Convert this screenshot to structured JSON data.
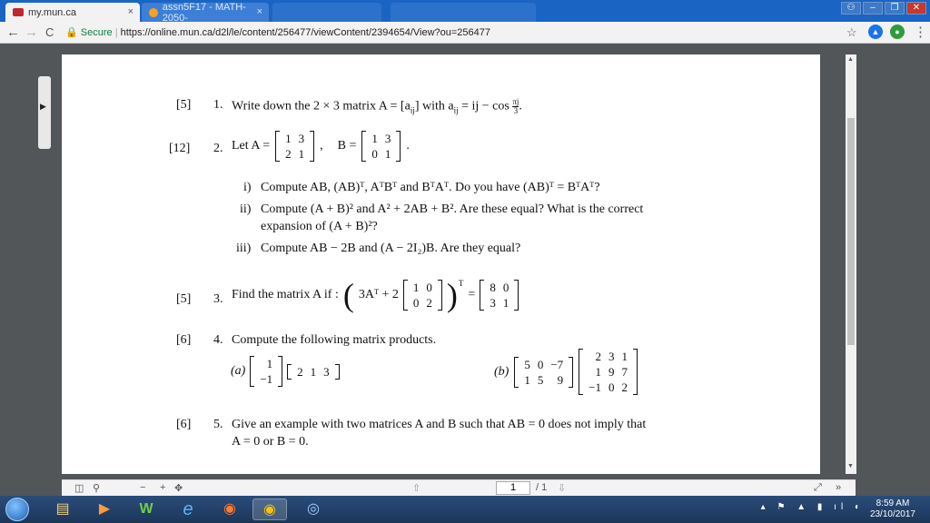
{
  "browser": {
    "tabs": [
      {
        "title": "my.mun.ca"
      },
      {
        "title": "assn5F17 - MATH-2050-"
      }
    ],
    "tab_close": "×",
    "nav": {
      "back": "←",
      "forward": "→",
      "reload": "C"
    },
    "secure_label": "Secure",
    "url": "https://online.mun.ca/d2l/le/content/256477/viewContent/2394654/View?ou=256477",
    "star": "☆",
    "menu": "⋮"
  },
  "doc": {
    "q1": {
      "marks": "[5]",
      "num": "1.",
      "text": "Write down the 2 × 3 matrix A = [a",
      "sub": "ij",
      "text2": "] with a",
      "sub2": "ij",
      "text3": " = ij − cos ",
      "frac_num": "πj",
      "frac_den": "3",
      "end": "."
    },
    "q2": {
      "marks": "[12]",
      "num": "2.",
      "let": "Let A =",
      "A": [
        [
          "1",
          "3"
        ],
        [
          "2",
          "1"
        ]
      ],
      "comma": ",",
      "B_label": "B =",
      "B": [
        [
          "1",
          "3"
        ],
        [
          "0",
          "1"
        ]
      ],
      "end": ".",
      "parts": [
        {
          "label": "i)",
          "text": "Compute AB, (AB)ᵀ, AᵀBᵀ and BᵀAᵀ. Do you have (AB)ᵀ = BᵀAᵀ?"
        },
        {
          "label": "ii)",
          "text": "Compute (A + B)² and A² + 2AB + B². Are these equal? What is the correct"
        },
        {
          "label": "",
          "text": "expansion of (A + B)²?"
        },
        {
          "label": "iii)",
          "text": "Compute AB − 2B and (A − 2I₂)B. Are they equal?"
        }
      ]
    },
    "q3": {
      "marks": "[5]",
      "num": "3.",
      "text": "Find the matrix A if :",
      "lhs1": "3Aᵀ + 2",
      "M": [
        [
          "1",
          "0"
        ],
        [
          "0",
          "2"
        ]
      ],
      "T": "T",
      "eq": "=",
      "R": [
        [
          "8",
          "0"
        ],
        [
          "3",
          "1"
        ]
      ]
    },
    "q4": {
      "marks": "[6]",
      "num": "4.",
      "text": "Compute the following matrix products.",
      "a_label": "(a)",
      "a_col": [
        [
          "1"
        ],
        [
          "−1"
        ]
      ],
      "a_row": [
        [
          "2",
          "1",
          "3"
        ]
      ],
      "b_label": "(b)",
      "b_m1": [
        [
          "5",
          "0",
          "−7"
        ],
        [
          "1",
          "5",
          "9"
        ]
      ],
      "b_m2": [
        [
          "2",
          "3",
          "1"
        ],
        [
          "1",
          "9",
          "7"
        ],
        [
          "−1",
          "0",
          "2"
        ]
      ]
    },
    "q5": {
      "marks": "[6]",
      "num": "5.",
      "line1": "Give an example with two matrices A and B such that AB = 0 does not imply that",
      "line2": "A = 0 or B = 0."
    }
  },
  "viewer": {
    "page_current": "1",
    "page_total": "/ 1",
    "zoom_out": "−",
    "zoom_in": "+"
  },
  "taskbar": {
    "time": "8:59 AM",
    "date": "23/10/2017"
  },
  "colors": {
    "taskbar": "#1c3658",
    "tabbar": "#1a64c4",
    "page_bg": "#ffffff",
    "viewer_bg": "#525659"
  }
}
